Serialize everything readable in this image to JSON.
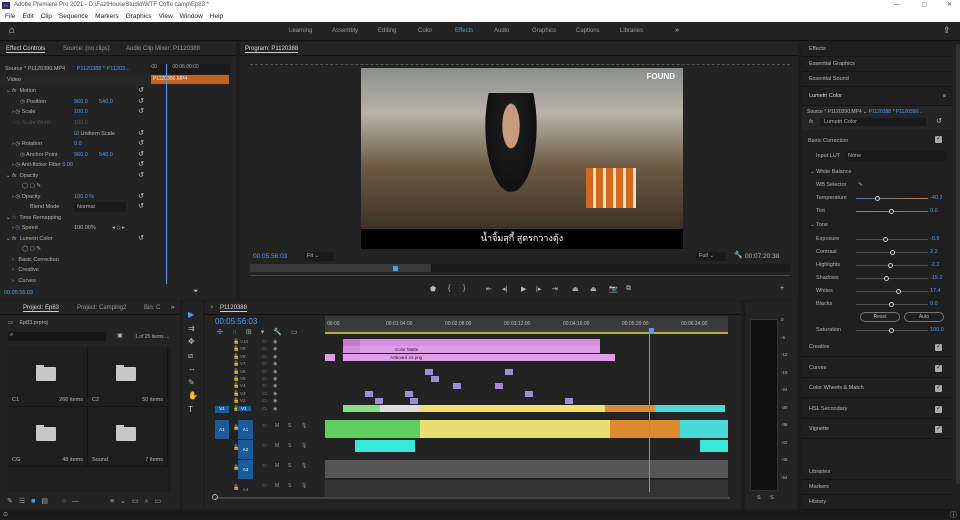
{
  "window": {
    "title": "Adobe Premiere Pro 2021 - D:\\FaztHouseStudio\\WTF Coffe camp\\Ep83 *"
  },
  "menu": [
    "File",
    "Edit",
    "Clip",
    "Sequence",
    "Markers",
    "Graphics",
    "View",
    "Window",
    "Help"
  ],
  "workspaces": [
    {
      "label": "Learning"
    },
    {
      "label": "Assembly"
    },
    {
      "label": "Editing"
    },
    {
      "label": "Color"
    },
    {
      "label": "Effects",
      "active": true
    },
    {
      "label": "Audio"
    },
    {
      "label": "Graphics"
    },
    {
      "label": "Captions"
    },
    {
      "label": "Libraries"
    }
  ],
  "effect_controls": {
    "tabs": [
      "Effect Controls",
      "Source: (no clips)",
      "Audio Clip Mixer: P1120388"
    ],
    "source": "Source * P1120390.MP4",
    "sequence": "P1120388 * P11203...",
    "ruler_time": "00:06:00:00",
    "ruler_left": ":00",
    "clip_name": "P1120390.MP4",
    "section": "Video",
    "motion": "Motion",
    "position_label": "Position",
    "position_x": "960.0",
    "position_y": "540.0",
    "scale_label": "Scale",
    "scale": "100.0",
    "scale_width_label": "Scale Width",
    "scale_width": "100.0",
    "uniform_scale": "Uniform Scale",
    "rotation_label": "Rotation",
    "rotation": "0.0",
    "anchor_label": "Anchor Point",
    "anchor_x": "960.0",
    "anchor_y": "540.0",
    "antiflicker_label": "Anti-flicker Filter",
    "antiflicker": "0.00",
    "opacity": "Opacity",
    "opacity_label": "Opacity",
    "opacity_value": "100.0 %",
    "blend_label": "Blend Mode",
    "blend": "Normal",
    "time_remap": "Time Remapping",
    "speed_label": "Speed",
    "speed": "100.00%",
    "lumetri": "Lumetri Color",
    "basic": "Basic Correction",
    "creative": "Creative",
    "curves": "Curves",
    "timecode": "00:05:56:03"
  },
  "program": {
    "title": "Program: P1120388",
    "subtitle": "น้ำจิ้มสุกี้ สูตรกวางตุ้ง",
    "watermark": "FOUND",
    "timecode": "00:05:56:03",
    "fit": "Fit",
    "quality": "Full",
    "duration": "00:07:20:38"
  },
  "right_panel": {
    "top_sections": [
      "Effects",
      "Essential Graphics",
      "Essential Sound"
    ],
    "lumetri_title": "Lumetri Color",
    "source": "Source * P1120390.MP4",
    "sequence": "P1120388 * P1120390...",
    "effect": "Lumetri Color",
    "basic_correction": "Basic Correction",
    "input_lut_label": "Input LUT",
    "input_lut": "None",
    "white_balance": "White Balance",
    "wb_selector": "WB Selector",
    "tone": "Tone",
    "sliders": [
      {
        "label": "Temperature",
        "value": "-40.2",
        "pos": 0.3
      },
      {
        "label": "Tint",
        "value": "0.0",
        "pos": 0.5
      },
      {
        "label": "Exposure",
        "value": "-0.9",
        "pos": 0.42
      },
      {
        "label": "Contrast",
        "value": "2.2",
        "pos": 0.52
      },
      {
        "label": "Highlights",
        "value": "-2.2",
        "pos": 0.49
      },
      {
        "label": "Shadows",
        "value": "-15.2",
        "pos": 0.43
      },
      {
        "label": "Whites",
        "value": "17.4",
        "pos": 0.6
      },
      {
        "label": "Blacks",
        "value": "0.0",
        "pos": 0.5
      },
      {
        "label": "Saturation",
        "value": "100.0",
        "pos": 0.5
      }
    ],
    "reset": "Reset",
    "auto": "Auto",
    "sections": [
      "Creative",
      "Curves",
      "Color Wheels & Match",
      "HSL Secondary",
      "Vignette"
    ],
    "bottom_sections": [
      "Libraries",
      "Markers",
      "History"
    ]
  },
  "project": {
    "tabs": [
      "Project: Ep83",
      "Project: Camping2",
      "Bin: C"
    ],
    "file": "Ep83.prproj",
    "count": "1 of 25 items ...",
    "bins": [
      {
        "name": "C1",
        "items": "266 items"
      },
      {
        "name": "C2",
        "items": "50 items"
      },
      {
        "name": "CG",
        "items": "48 items"
      },
      {
        "name": "Sound",
        "items": "7 items"
      }
    ]
  },
  "timeline": {
    "title": "P1120388",
    "timecode": "00:05:56:03",
    "ruler": [
      "00:00",
      "00:01:04:00",
      "00:02:08:00",
      "00:03:12:00",
      "00:04:16:00",
      "00:05:20:00",
      "00:06:24:00"
    ],
    "video_tracks": [
      "V10",
      "V9",
      "V8",
      "V7",
      "V6",
      "V5",
      "V4",
      "V3",
      "V2",
      "V1"
    ],
    "audio_tracks": [
      "A1",
      "A2",
      "A3",
      "A4"
    ],
    "clip_labels": [
      "Color Matte",
      "Artboard 22.png",
      "Color Matte",
      "Artboard 22.png",
      "Color Matte"
    ]
  },
  "meters": {
    "scale": [
      "0",
      "-6",
      "-12",
      "-18",
      "-24",
      "-30",
      "-36",
      "-42",
      "-48",
      "-54"
    ],
    "solo": [
      "S",
      "S"
    ]
  }
}
